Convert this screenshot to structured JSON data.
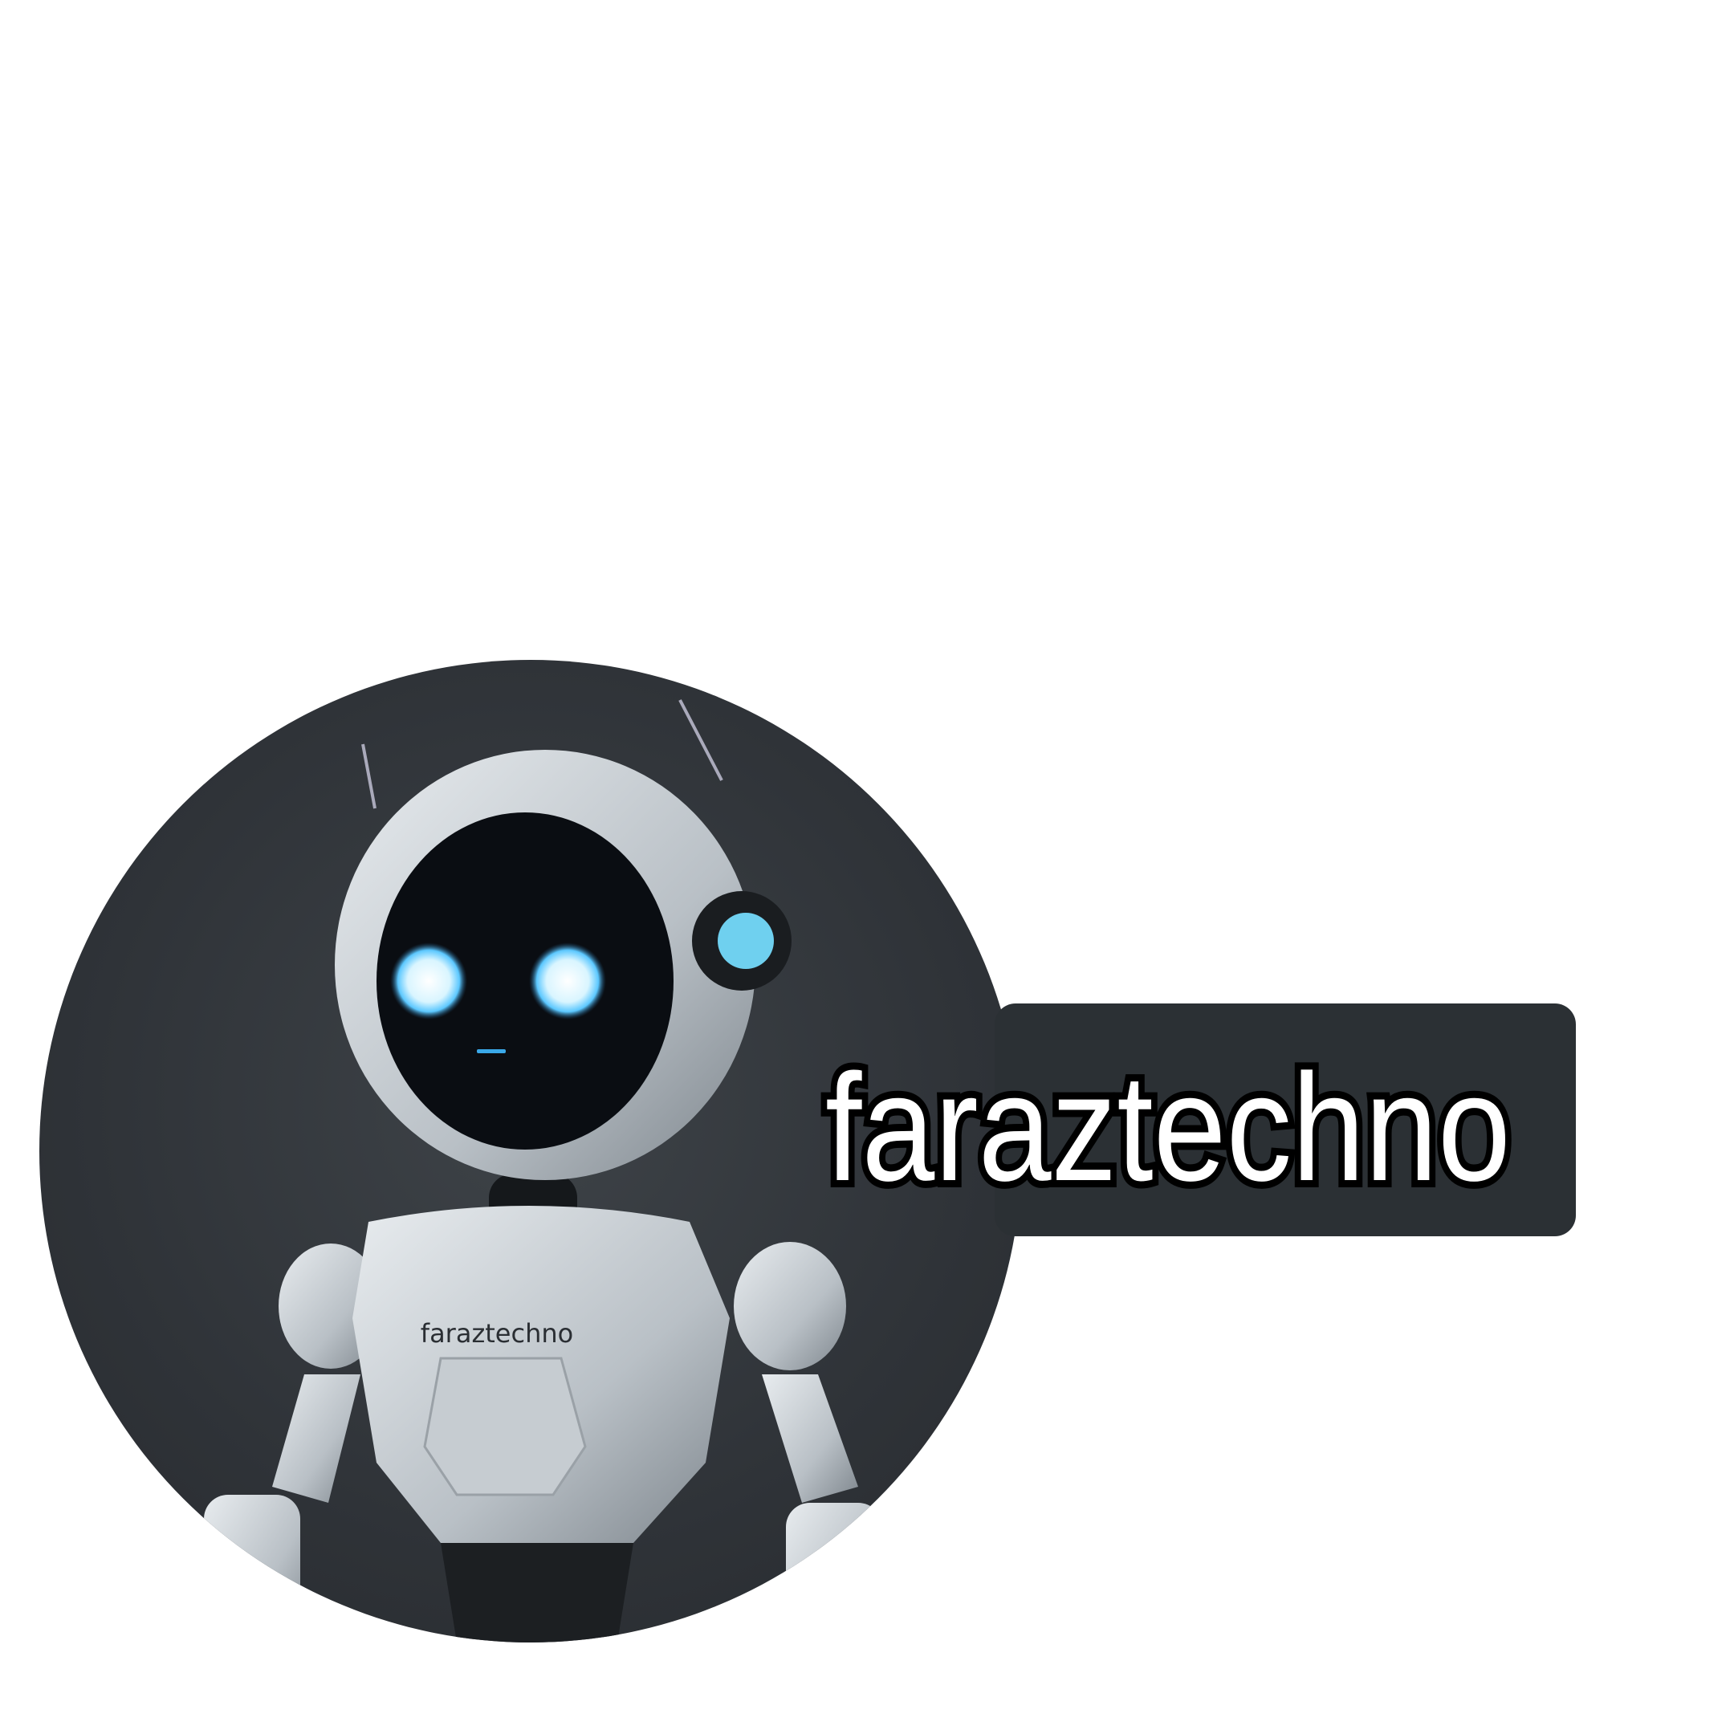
{
  "profile": {
    "username": "faraztechno",
    "avatar_shirt_text": "faraztechno",
    "avatar_description_icon": "robot-avatar-icon"
  },
  "colors": {
    "label_background": "#2b3034",
    "avatar_background": "#2f3338",
    "eye_glow": "#7fd8ff"
  }
}
